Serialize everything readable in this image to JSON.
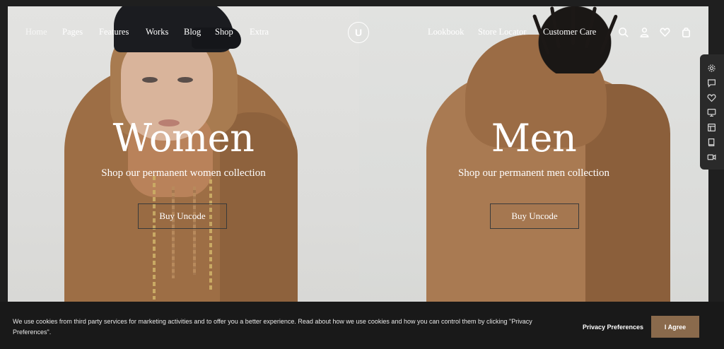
{
  "header": {
    "nav_left": [
      "Home",
      "Pages",
      "Features",
      "Works",
      "Blog",
      "Shop",
      "Extra"
    ],
    "logo_letter": "U",
    "nav_right": [
      "Lookbook",
      "Store Locator",
      "Customer Care"
    ],
    "icons": [
      "search-icon",
      "user-icon",
      "heart-icon",
      "bag-icon"
    ]
  },
  "hero": {
    "left": {
      "title": "Women",
      "subtitle": "Shop our permanent women collection",
      "button": "Buy Uncode"
    },
    "right": {
      "title": "Men",
      "subtitle": "Shop our permanent men collection",
      "button": "Buy Uncode"
    }
  },
  "side_toolbar": {
    "icons": [
      "gear-icon",
      "chat-icon",
      "heart-icon",
      "monitor-icon",
      "layout-icon",
      "book-icon",
      "video-icon"
    ]
  },
  "cookie_bar": {
    "text": "We use cookies from third party services for marketing activities and to offer you a better experience. Read about how we use cookies and how you can control them by clicking \"Privacy Preferences\".",
    "preferences_label": "Privacy Preferences",
    "agree_label": "I Agree"
  },
  "colors": {
    "page_bg": "#1f1f1f",
    "hoodie": "#9d6e45",
    "accent_button": "#8a6a4c",
    "cookie_bg": "#191919"
  }
}
